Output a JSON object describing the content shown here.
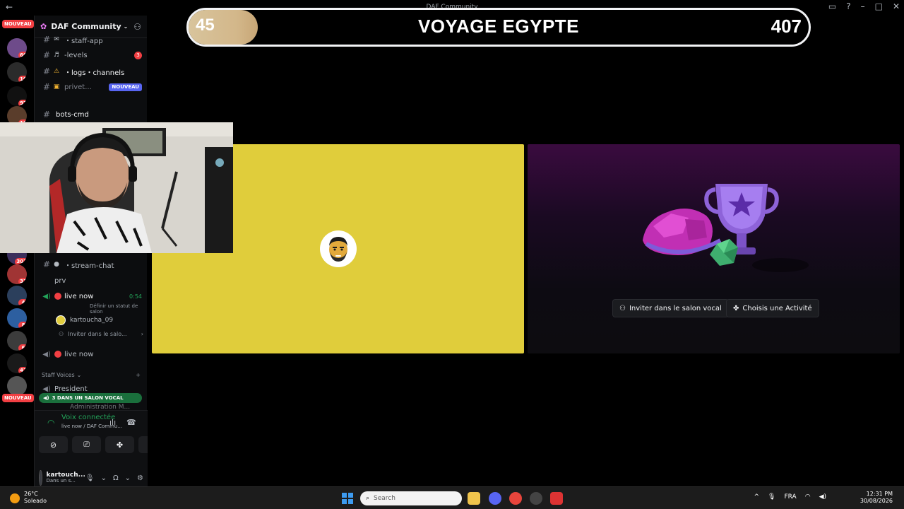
{
  "window": {
    "title": "DAF Community"
  },
  "rail": {
    "top_badge": "NOUVEAU",
    "bottom_badge": "NOUVEAU",
    "servers": [
      {
        "badge": "66"
      },
      {
        "badge": "10"
      },
      {
        "badge": "97"
      },
      {
        "badge": "13"
      },
      {
        "badge": "303"
      },
      {
        "badge": "33"
      },
      {
        "badge": "4"
      },
      {
        "badge": "8"
      },
      {
        "badge": "6"
      },
      {
        "badge": "42"
      }
    ]
  },
  "sidebar": {
    "server_name": "DAF Community",
    "channels": [
      {
        "emoji": "✉",
        "label": "・staff-app"
      },
      {
        "emoji": "♬",
        "label": "-levels",
        "count": "3"
      },
      {
        "emoji": "⚠",
        "label": "・logs・channels"
      },
      {
        "emoji": "🔒",
        "label": "privet...",
        "tag": "NOUVEAU"
      },
      {
        "emoji": "",
        "label": "bots-cmd"
      },
      {
        "emoji": "💬",
        "label": "・stream-chat"
      },
      {
        "emoji": "",
        "label": "prv"
      }
    ],
    "live_channel": {
      "label": "live now",
      "timer": "0:54",
      "status_hint": "Définir un statut de salon"
    },
    "voice_user": "kartoucha_09",
    "invite_label": "Inviter dans le salo...",
    "live_channel_2": {
      "label": "live now"
    },
    "category": "Staff Voices",
    "president": "President",
    "admin": "Administration M...",
    "vc_banner": "3 DANS UN SALON VOCAL"
  },
  "voice_panel": {
    "status": "Voix connectée",
    "subtitle": "live now / DAF Commu..."
  },
  "user_panel": {
    "username": "kartouch...",
    "status": "Dans un s..."
  },
  "overlay": {
    "left_number": "45",
    "title": "VOYAGE EGYPTE",
    "right_number": "407"
  },
  "activity": {
    "invite_button": "Inviter dans le salon vocal",
    "choose_button": "Choisis une Activité"
  },
  "taskbar": {
    "temperature": "26°C",
    "weather": "Soleado",
    "search_placeholder": "Search",
    "language": "FRA",
    "time": "12:31 PM",
    "date": "30/08/2026"
  },
  "colors": {
    "yellow_tile": "#e0cd3b",
    "online_green": "#23a55a",
    "alert_red": "#f23f43",
    "blurple": "#5865f2"
  }
}
